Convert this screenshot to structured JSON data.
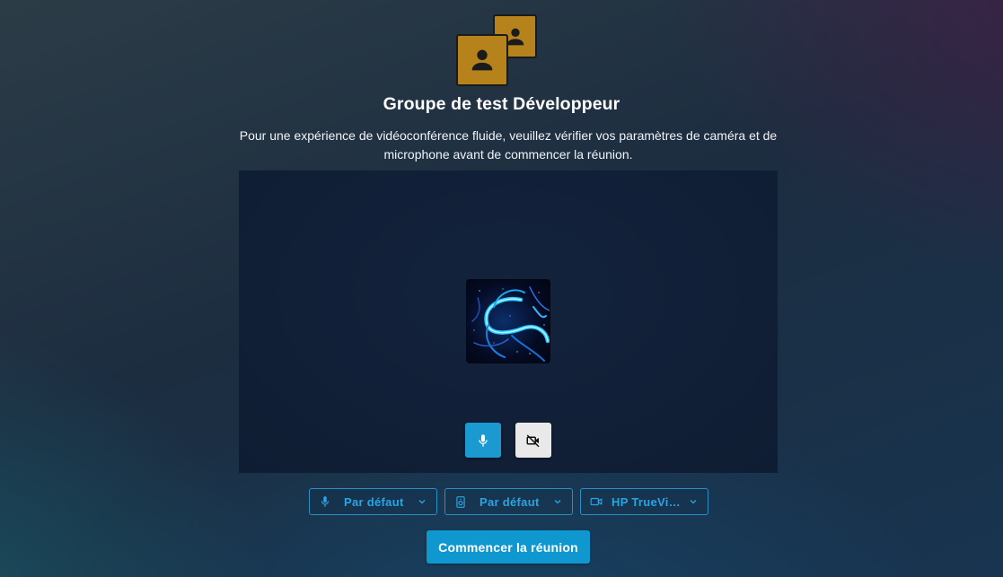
{
  "meeting": {
    "title": "Groupe de test Développeur",
    "description": "Pour une expérience de vidéoconférence fluide, veuillez vérifier vos paramètres de caméra et de microphone avant de commencer la réunion."
  },
  "group_avatar": {
    "icon": "person-icon",
    "color": "#b5821b"
  },
  "preview": {
    "avatar_image": "kali-dragon-avatar",
    "mic_button": {
      "icon": "microphone-icon",
      "state": "on",
      "color": "#1b9ad1"
    },
    "camera_button": {
      "icon": "video-off-icon",
      "state": "off",
      "color": "#e9e9e9"
    }
  },
  "devices": {
    "microphone": {
      "icon": "microphone-icon",
      "label": "Par défaut"
    },
    "speaker": {
      "icon": "speaker-icon",
      "label": "Par défaut"
    },
    "camera": {
      "icon": "video-camera-icon",
      "label": "HP TrueVision HD Camera"
    }
  },
  "actions": {
    "start_label": "Commencer la réunion"
  },
  "colors": {
    "accent": "#0f97d0",
    "selector_text": "#2ca4e3"
  }
}
